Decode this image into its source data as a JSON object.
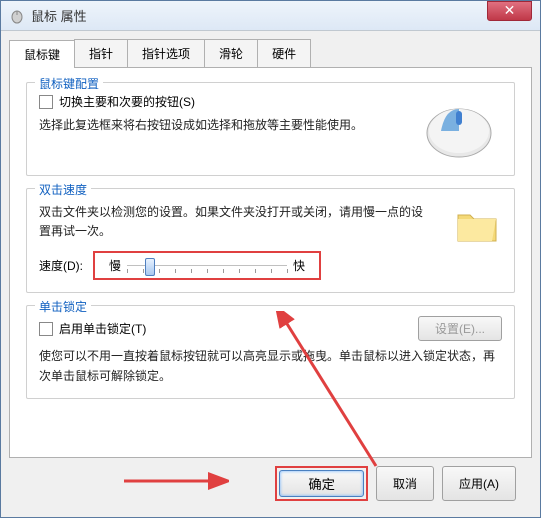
{
  "window": {
    "title": "鼠标 属性"
  },
  "tabs": {
    "items": [
      {
        "label": "鼠标键"
      },
      {
        "label": "指针"
      },
      {
        "label": "指针选项"
      },
      {
        "label": "滑轮"
      },
      {
        "label": "硬件"
      }
    ]
  },
  "group_buttons": {
    "title": "鼠标键配置",
    "switch_label": "切换主要和次要的按钮(S)",
    "desc": "选择此复选框来将右按钮设成如选择和拖放等主要性能使用。"
  },
  "group_dblclick": {
    "title": "双击速度",
    "desc": "双击文件夹以检测您的设置。如果文件夹没打开或关闭，请用慢一点的设置再试一次。",
    "speed_label": "速度(D):",
    "slow": "慢",
    "fast": "快"
  },
  "group_clicklock": {
    "title": "单击锁定",
    "enable_label": "启用单击锁定(T)",
    "settings_btn": "设置(E)...",
    "desc": "使您可以不用一直按着鼠标按钮就可以高亮显示或拖曳。单击鼠标以进入锁定状态，再次单击鼠标可解除锁定。"
  },
  "buttons": {
    "ok": "确定",
    "cancel": "取消",
    "apply": "应用(A)"
  }
}
